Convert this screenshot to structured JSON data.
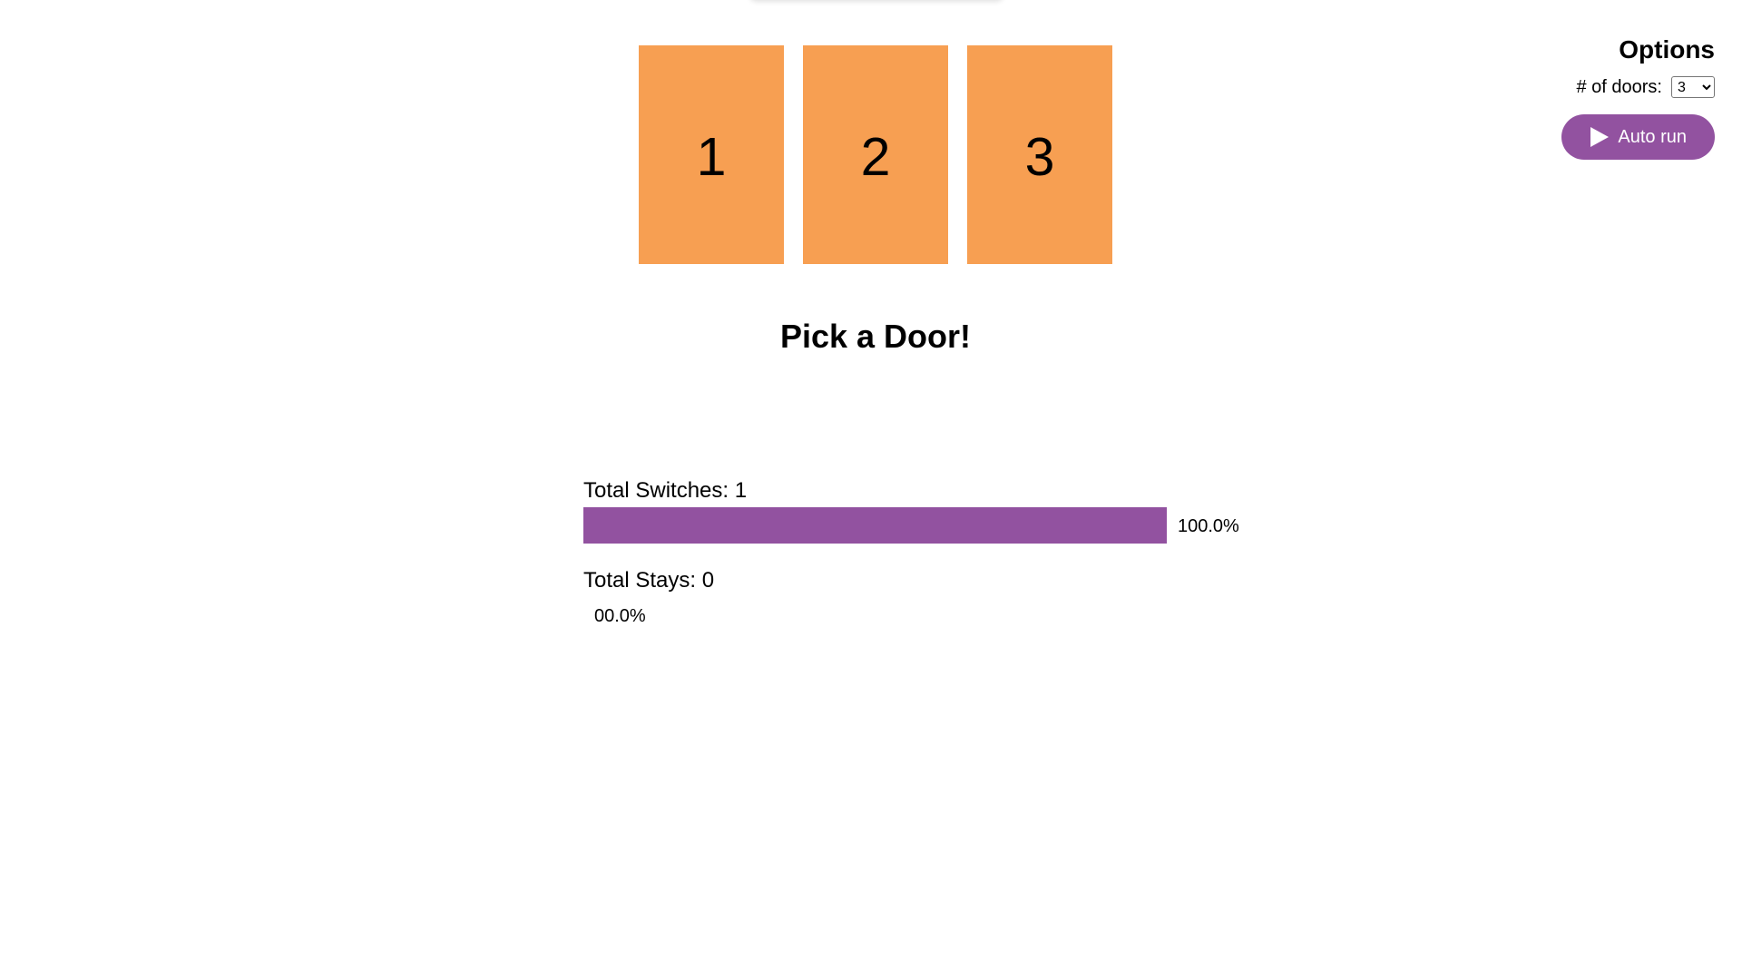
{
  "doors": [
    {
      "number": "1"
    },
    {
      "number": "2"
    },
    {
      "number": "3"
    }
  ],
  "prompt": "Pick a Door!",
  "stats": {
    "switches": {
      "label": "Total Switches: 1",
      "fraction": 1.0,
      "percent_text": "100.0%"
    },
    "stays": {
      "label": "Total Stays: 0",
      "fraction": 0.0,
      "percent_text": "00.0%"
    }
  },
  "options": {
    "title": "Options",
    "doors_label": "# of doors:",
    "doors_selected": "3",
    "autorun_label": "Auto run"
  },
  "colors": {
    "door": "#f79f52",
    "accent": "#9252a0"
  },
  "icons": {
    "autorun": "play-icon",
    "select": "chevron-down-icon"
  }
}
